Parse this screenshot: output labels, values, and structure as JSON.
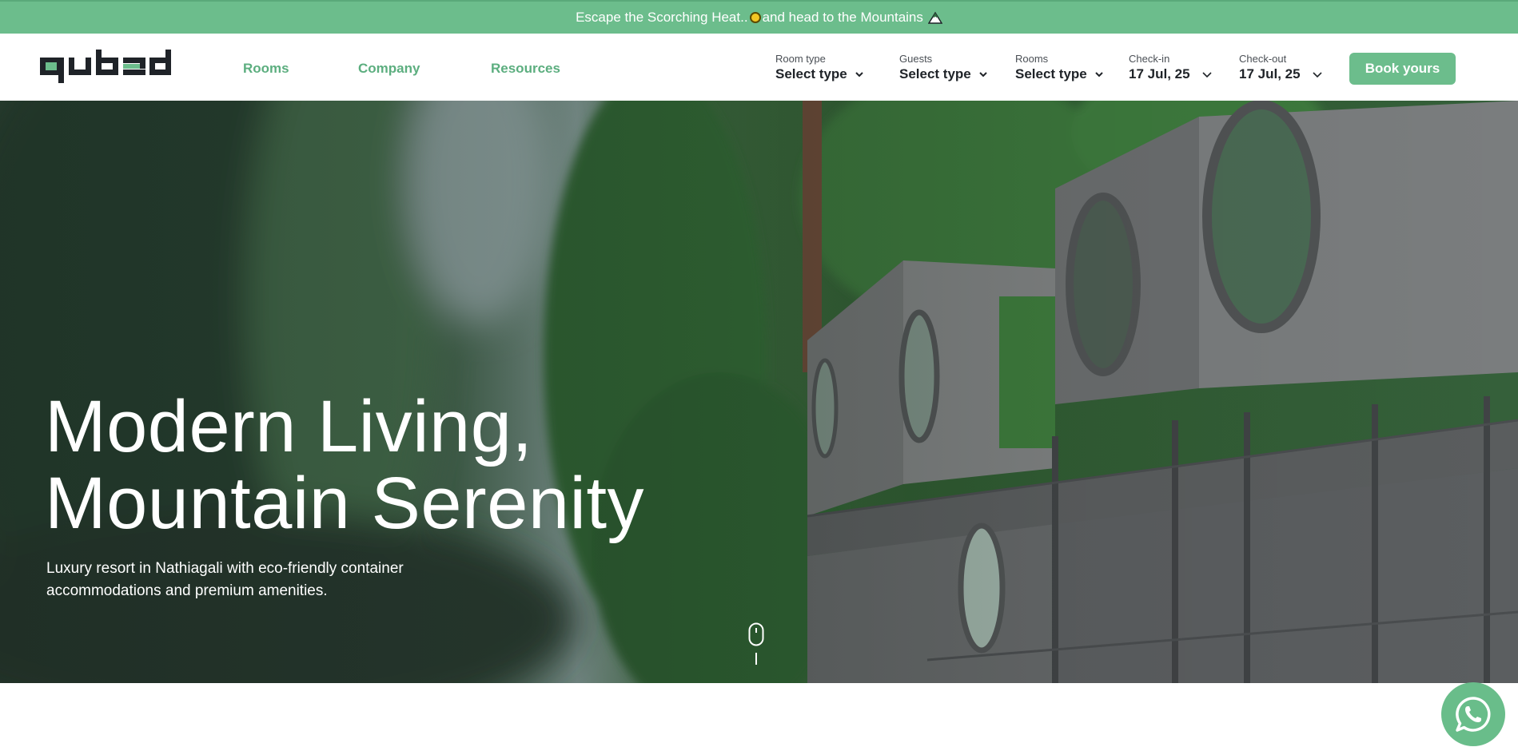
{
  "announcement": {
    "text_before": "Escape the Scorching Heat..",
    "sun_icon": "sun-emoji",
    "text_after": " and head to the Mountains",
    "mountain_icon": "mountain-emoji"
  },
  "brand": {
    "logo_text": "qubed",
    "accent": "#6cbd8c",
    "dark": "#1f2328"
  },
  "nav": {
    "links": [
      {
        "label": "Rooms"
      },
      {
        "label": "Company"
      },
      {
        "label": "Resources"
      }
    ]
  },
  "booking": {
    "room_type": {
      "label": "Room type",
      "value": "Select type"
    },
    "guests": {
      "label": "Guests",
      "value": "Select type"
    },
    "rooms": {
      "label": "Rooms",
      "value": "Select type"
    },
    "check_in": {
      "label": "Check-in",
      "value": "17 Jul, 25"
    },
    "check_out": {
      "label": "Check-out",
      "value": "17 Jul, 25"
    },
    "cta": "Book yours"
  },
  "hero": {
    "title_line1": "Modern Living,",
    "title_line2": "Mountain Serenity",
    "subtitle": "Luxury resort in Nathiagali with eco-friendly container accommodations and premium amenities.",
    "scroll_icon": "mouse-scroll-icon"
  },
  "whatsapp": {
    "icon": "whatsapp-icon",
    "color": "#69bd8a"
  }
}
